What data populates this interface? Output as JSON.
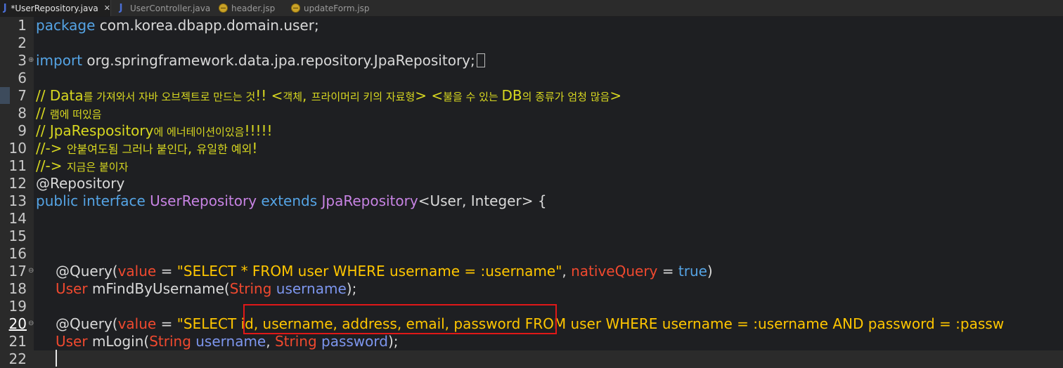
{
  "tabs": [
    {
      "label": "*UserRepository.java",
      "icon": "java-file-icon"
    },
    {
      "label": "UserController.java",
      "icon": "java-file-icon"
    },
    {
      "label": "header.jsp",
      "icon": "jsp-file-icon"
    },
    {
      "label": "updateForm.jsp",
      "icon": "jsp-file-icon"
    }
  ],
  "tab_icon_java": "J",
  "close_glyph": "✕",
  "editor": {
    "line_numbers": [
      "1",
      "2",
      "3",
      "6",
      "7",
      "8",
      "9",
      "10",
      "11",
      "12",
      "13",
      "14",
      "15",
      "16",
      "17",
      "18",
      "19",
      "20",
      "21",
      "22"
    ],
    "l1": {
      "kw": "package",
      "rest": " com.korea.dbapp.domain.user;"
    },
    "l3": {
      "kw": "import",
      "rest": " org.springframework.data.jpa.repository.JpaRepository;"
    },
    "l7": {
      "a": "// Data",
      "b": "를 가져와서 자바 오브젝트로 만드는 것",
      "c": "!! <",
      "d": "객체",
      "e": ", ",
      "f": "프라이머리 키의 자료형",
      "g": "> <",
      "h": "불을 수 있는 ",
      "i": "DB",
      "j": "의 종류가 엄청 많음",
      "k": ">"
    },
    "l8": {
      "a": "// ",
      "b": "램에 떠있음"
    },
    "l9": {
      "a": "// JpaRespository",
      "b": "에 에너테이션이있음",
      "c": "!!!!!"
    },
    "l10": {
      "a": "//-> ",
      "b": "안붙여도됨 그러나 붙인다",
      "c": ", ",
      "d": "유일한 예외",
      "e": "!"
    },
    "l11": {
      "a": "//-> ",
      "b": "지금은 붙이자"
    },
    "l12": {
      "text": "@Repository"
    },
    "l13": {
      "kw1": "public",
      "kw2": "interface",
      "cls": "UserRepository",
      "kw3": "extends",
      "sup": "JpaRepository",
      "gen": "<User, Integer> {"
    },
    "l17": {
      "an": "@Query(",
      "attr1": "value",
      "eq": " = ",
      "str": "\"SELECT * FROM user WHERE username = :username\"",
      "comma": ", ",
      "attr2": "nativeQuery",
      "eq2": " = ",
      "kw": "true",
      "close": ")"
    },
    "l18": {
      "ty": "User",
      "name": " mFindByUsername(",
      "pty": "String",
      "sp": " ",
      "prm": "username",
      "end": ");"
    },
    "l20": {
      "an": "@Query(",
      "attr1": "value",
      "eq": " = ",
      "str": "\"SELECT id, username, address, email, password FROM user WHERE username = :username AND password = :passw"
    },
    "l21": {
      "ty": "User",
      "name": " mLogin(",
      "pty1": "String",
      "sp1": " ",
      "prm1": "username",
      "comma": ", ",
      "pty2": "String",
      "sp2": " ",
      "prm2": "password",
      "end": ");"
    }
  }
}
